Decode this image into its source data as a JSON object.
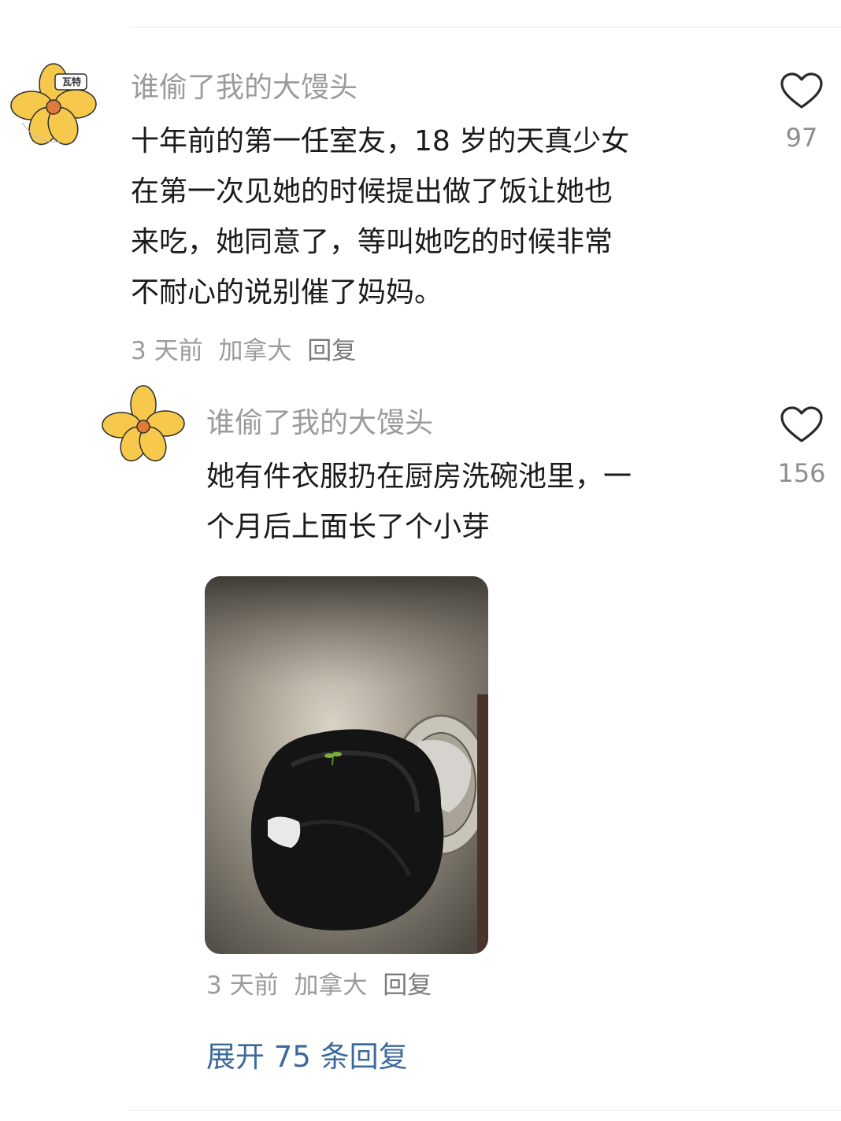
{
  "comments": [
    {
      "username": "谁偷了我的大馒头",
      "avatar_badge": "瓦特",
      "lines": [
        "十年前的第一任室友，18 岁的天真少女",
        "在第一次见她的时候提出做了饭让她也",
        "来吃，她同意了，等叫她吃的时候非常",
        "不耐心的说别催了妈妈。"
      ],
      "time": "3 天前",
      "location": "加拿大",
      "reply_label": "回复",
      "likes": "97"
    },
    {
      "username": "谁偷了我的大馒头",
      "lines": [
        "她有件衣服扔在厨房洗碗池里，一",
        "个月后上面长了个小芽"
      ],
      "time": "3 天前",
      "location": "加拿大",
      "reply_label": "回复",
      "likes": "156"
    }
  ],
  "expand_replies": "展开 75 条回复",
  "icons": {
    "like": "heart-outline-icon",
    "avatar": "yellow-flower-icon"
  },
  "colors": {
    "accent_link": "#3d6a9c",
    "muted_text": "#9b9b9b",
    "flower": "#f6c84c"
  }
}
